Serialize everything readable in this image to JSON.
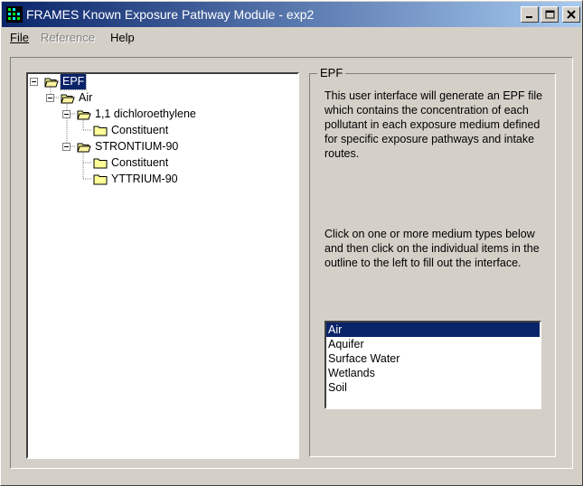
{
  "window": {
    "title": "FRAMES Known Exposure Pathway Module - exp2",
    "minimize_label": "_",
    "maximize_label": "□",
    "close_label": "✕"
  },
  "menu": {
    "file": "File",
    "reference": "Reference",
    "help": "Help"
  },
  "tree": {
    "nodes": [
      {
        "label": "EPF",
        "level": 0,
        "selected": true
      },
      {
        "label": "Air",
        "level": 1
      },
      {
        "label": "1,1 dichloroethylene",
        "level": 2
      },
      {
        "label": "Constituent",
        "level": 3
      },
      {
        "label": "STRONTIUM-90",
        "level": 2
      },
      {
        "label": "Constituent",
        "level": 3
      },
      {
        "label": "YTTRIUM-90",
        "level": 3
      }
    ]
  },
  "panel": {
    "title": "EPF",
    "description": "This user interface will generate an EPF file which contains the concentration of each pollutant in each exposure medium defined for specific exposure pathways and intake routes.",
    "instructions": "Click on one or more medium types below and then click on the individual items in the outline to the left to fill out the interface."
  },
  "media": {
    "items": [
      "Air",
      "Aquifer",
      "Surface Water",
      "Wetlands",
      "Soil"
    ],
    "selected": "Air"
  },
  "colors": {
    "titlebar_start": "#0a246a",
    "titlebar_end": "#a6caf0",
    "selection": "#0a246a",
    "face": "#d4d0c8"
  }
}
